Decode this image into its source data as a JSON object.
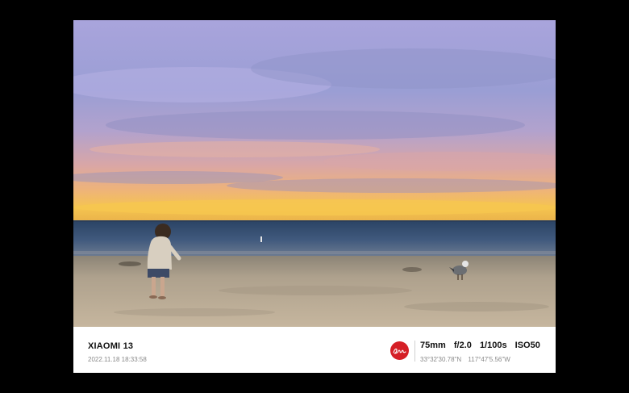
{
  "caption": {
    "device": "XIAOMI 13",
    "datetime": "2022.11.18  18:33:58",
    "brand_logo_text": "Leica",
    "exif": {
      "focal_length": "75mm",
      "aperture": "f/2.0",
      "shutter": "1/100s",
      "iso": "ISO50"
    },
    "gps": {
      "latitude": "33°32'30.78\"N",
      "longitude": "117°47'5.56\"W"
    }
  },
  "colors": {
    "background": "#000000",
    "frame": "#ffffff",
    "logo_red": "#d51f26",
    "sky_top": "#9fa0d8",
    "horizon_glow": "#f3c14e",
    "ocean": "#3d5577",
    "sand": "#bdaf9a"
  },
  "photo": {
    "subject_icons": [
      "toddler-figure",
      "seagull-figure"
    ]
  }
}
